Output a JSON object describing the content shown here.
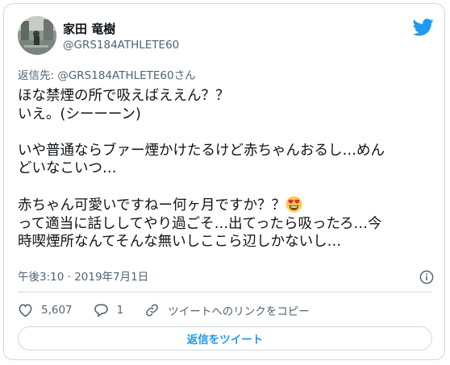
{
  "user": {
    "name": "家田 竜樹",
    "handle": "@GRS184ATHLETE60"
  },
  "reply_to": {
    "prefix": "返信先: ",
    "handle": "@GRS184ATHLETE60さん"
  },
  "tweet": {
    "lines": [
      "ほな禁煙の所で吸えばええん？？",
      "いえ。(シーーーン)",
      "",
      "いや普通ならブァー煙かけたるけど赤ちゃんおるし…めん",
      "どいなこいつ…",
      "",
      "赤ちゃん可愛いですねー何ヶ月ですか？？",
      "って適当に話ししてやり過ごそ…出てったら吸ったろ…今",
      "時喫煙所なんてそんな無いしここら辺しかないし…"
    ],
    "emoji": "smiling-face-with-heart-eyes"
  },
  "meta": {
    "time": "午後3:10",
    "separator": " · ",
    "date": "2019年7月1日"
  },
  "actions": {
    "likes": "5,607",
    "replies": "1",
    "copy_link": "ツイートへのリンクをコピー"
  },
  "reply_button": "返信をツイート",
  "colors": {
    "accent": "#1d9bf0",
    "secondary_text": "#536471",
    "border": "#cfd9de"
  }
}
